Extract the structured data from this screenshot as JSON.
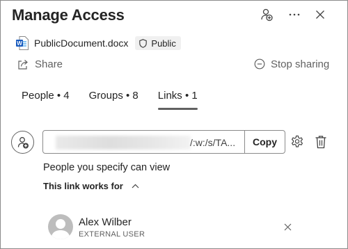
{
  "header": {
    "title": "Manage Access"
  },
  "file": {
    "name": "PublicDocument.docx",
    "badge": "Public"
  },
  "actions": {
    "share": "Share",
    "stop_sharing": "Stop sharing"
  },
  "tabs": [
    {
      "label": "People • 4"
    },
    {
      "label": "Groups • 8"
    },
    {
      "label": "Links • 1"
    }
  ],
  "active_tab": "Links • 1",
  "link": {
    "url_visible": "/:w:/s/TA...",
    "copy_label": "Copy",
    "permission": "People you specify can view",
    "works_for_label": "This link works for"
  },
  "users": [
    {
      "name": "Alex Wilber",
      "type": "EXTERNAL USER"
    }
  ],
  "colors": {
    "text": "#242424",
    "secondary": "#616161",
    "word_blue": "#185abd",
    "border": "#8a8a8a"
  }
}
